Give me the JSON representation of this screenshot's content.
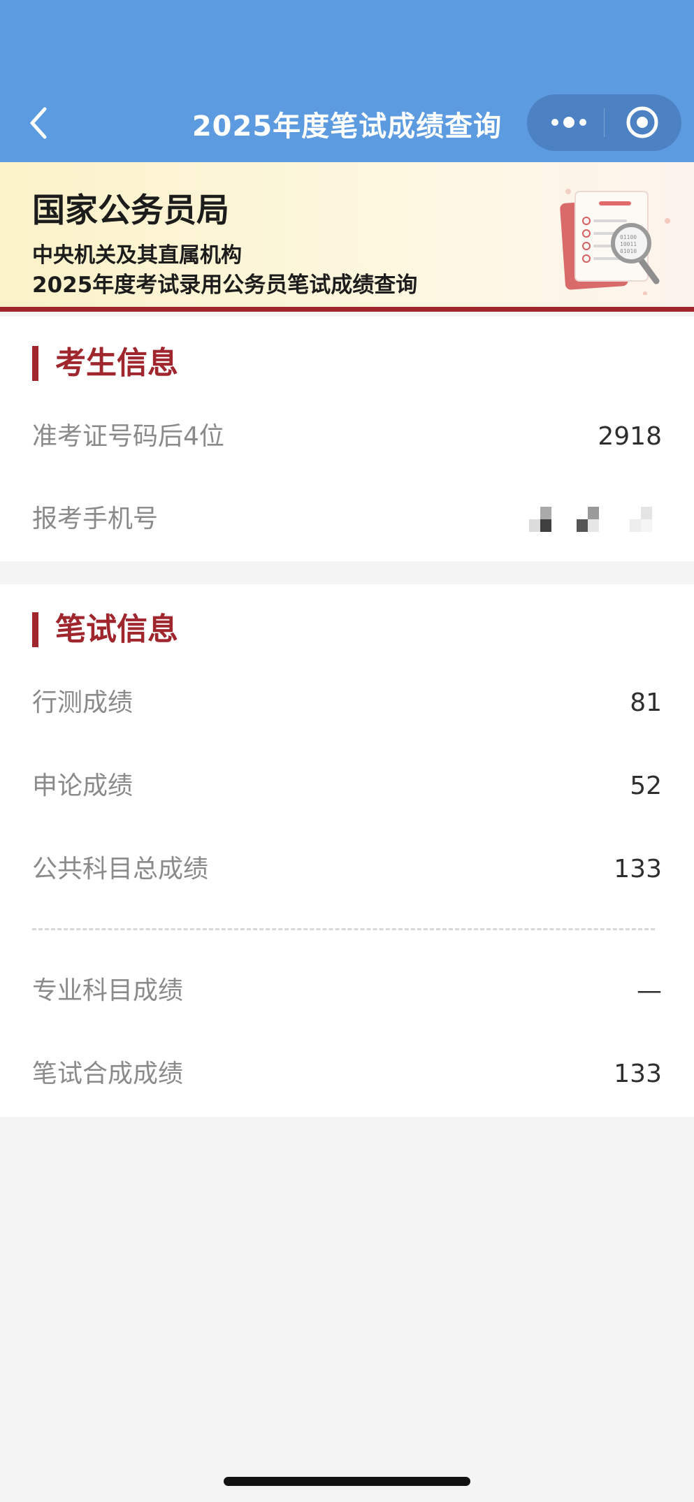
{
  "nav": {
    "title": "2025年度笔试成绩查询",
    "back_icon": "chevron-left-icon",
    "more_icon": "more-dots-icon",
    "close_icon": "target-circle-icon",
    "background_color": "#5d9be0"
  },
  "banner": {
    "org_name": "国家公务员局",
    "subtitle_line1": "中央机关及其直属机构",
    "subtitle_line2": "2025年度考试录用公务员笔试成绩查询",
    "illustration_icon": "checklist-magnifier-icon",
    "accent_color": "#a0262d"
  },
  "candidate_section": {
    "title": "考生信息",
    "rows": [
      {
        "label": "准考证号码后4位",
        "value": "2918"
      },
      {
        "label": "报考手机号",
        "value": ""
      }
    ]
  },
  "exam_section": {
    "title": "笔试信息",
    "rows": [
      {
        "label": "行测成绩",
        "value": "81"
      },
      {
        "label": "申论成绩",
        "value": "52"
      },
      {
        "label": "公共科目总成绩",
        "value": "133"
      },
      {
        "label": "专业科目成绩",
        "value": "—"
      },
      {
        "label": "笔试合成成绩",
        "value": "133"
      }
    ]
  }
}
